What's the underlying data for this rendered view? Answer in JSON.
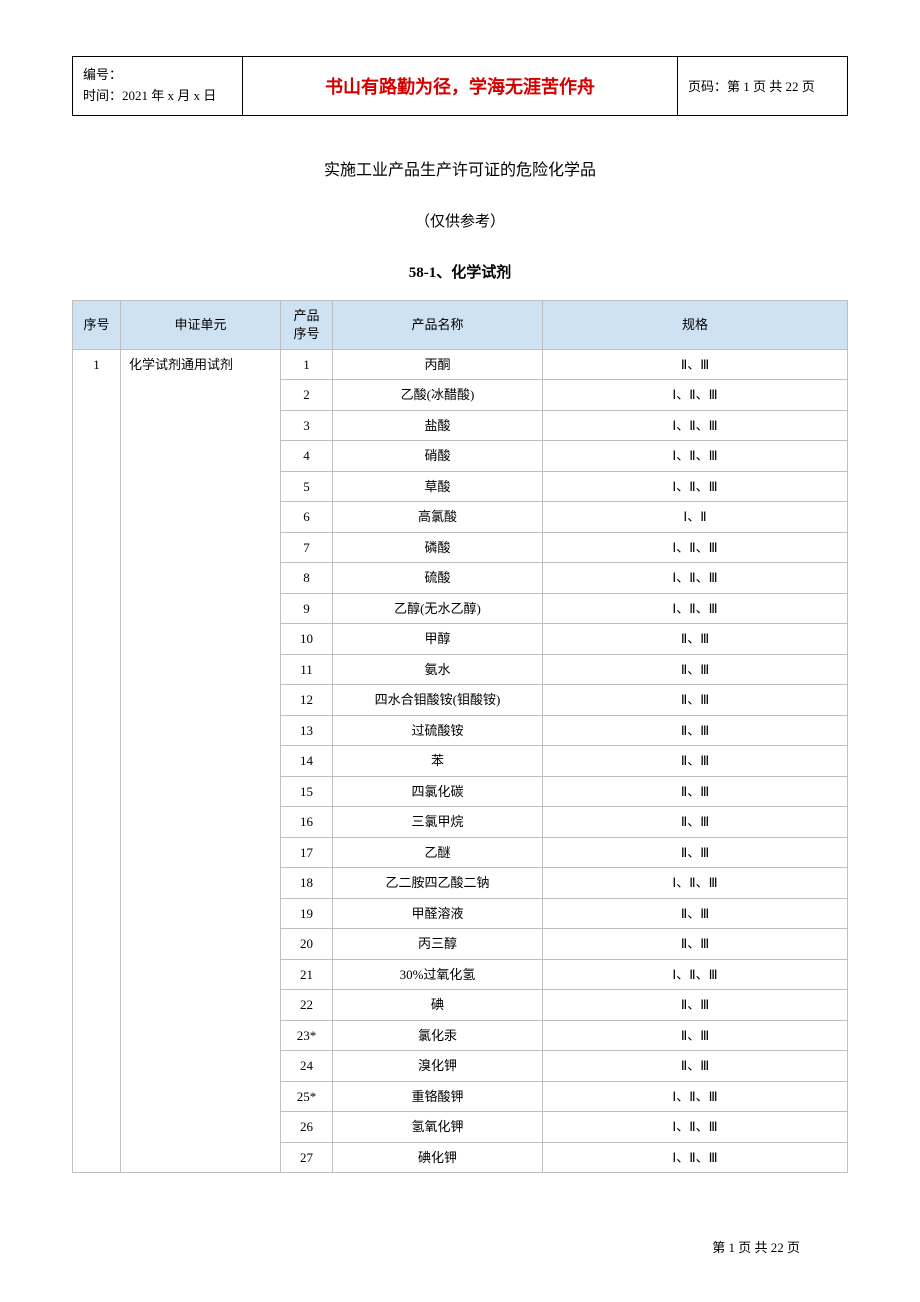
{
  "header": {
    "left_line1": "编号：",
    "left_line2": "时间：2021 年 x 月 x 日",
    "mid": "书山有路勤为径，学海无涯苦作舟",
    "right": "页码：第 1 页  共 22 页"
  },
  "doc": {
    "title": "实施工业产品生产许可证的危险化学品",
    "sub": "（仅供参考）",
    "section": "58-1、化学试剂"
  },
  "table": {
    "headers": {
      "seq": "序号",
      "unit": "申证单元",
      "pn_line1": "产品",
      "pn_line2": "序号",
      "name": "产品名称",
      "spec": "规格"
    },
    "seq_value": "1",
    "unit_value": "化学试剂通用试剂",
    "rows": [
      {
        "pn": "1",
        "name": "丙酮",
        "spec": "Ⅱ、Ⅲ"
      },
      {
        "pn": "2",
        "name": "乙酸(冰醋酸)",
        "spec": "Ⅰ、Ⅱ、Ⅲ"
      },
      {
        "pn": "3",
        "name": "盐酸",
        "spec": "Ⅰ、Ⅱ、Ⅲ"
      },
      {
        "pn": "4",
        "name": "硝酸",
        "spec": "Ⅰ、Ⅱ、Ⅲ"
      },
      {
        "pn": "5",
        "name": "草酸",
        "spec": "Ⅰ、Ⅱ、Ⅲ"
      },
      {
        "pn": "6",
        "name": "高氯酸",
        "spec": "Ⅰ、Ⅱ"
      },
      {
        "pn": "7",
        "name": "磷酸",
        "spec": "Ⅰ、Ⅱ、Ⅲ"
      },
      {
        "pn": "8",
        "name": "硫酸",
        "spec": "Ⅰ、Ⅱ、Ⅲ"
      },
      {
        "pn": "9",
        "name": "乙醇(无水乙醇)",
        "spec": "Ⅰ、Ⅱ、Ⅲ"
      },
      {
        "pn": "10",
        "name": "甲醇",
        "spec": "Ⅱ、Ⅲ"
      },
      {
        "pn": "11",
        "name": "氨水",
        "spec": "Ⅱ、Ⅲ"
      },
      {
        "pn": "12",
        "name": "四水合钼酸铵(钼酸铵)",
        "spec": "Ⅱ、Ⅲ"
      },
      {
        "pn": "13",
        "name": "过硫酸铵",
        "spec": "Ⅱ、Ⅲ"
      },
      {
        "pn": "14",
        "name": "苯",
        "spec": "Ⅱ、Ⅲ"
      },
      {
        "pn": "15",
        "name": "四氯化碳",
        "spec": "Ⅱ、Ⅲ"
      },
      {
        "pn": "16",
        "name": "三氯甲烷",
        "spec": "Ⅱ、Ⅲ"
      },
      {
        "pn": "17",
        "name": "乙醚",
        "spec": "Ⅱ、Ⅲ"
      },
      {
        "pn": "18",
        "name": "乙二胺四乙酸二钠",
        "spec": "Ⅰ、Ⅱ、Ⅲ"
      },
      {
        "pn": "19",
        "name": "甲醛溶液",
        "spec": "Ⅱ、Ⅲ"
      },
      {
        "pn": "20",
        "name": "丙三醇",
        "spec": "Ⅱ、Ⅲ"
      },
      {
        "pn": "21",
        "name": "30%过氧化氢",
        "spec": "Ⅰ、Ⅱ、Ⅲ"
      },
      {
        "pn": "22",
        "name": "碘",
        "spec": "Ⅱ、Ⅲ"
      },
      {
        "pn": "23*",
        "name": "氯化汞",
        "spec": "Ⅱ、Ⅲ"
      },
      {
        "pn": "24",
        "name": "溴化钾",
        "spec": "Ⅱ、Ⅲ"
      },
      {
        "pn": "25*",
        "name": "重铬酸钾",
        "spec": "Ⅰ、Ⅱ、Ⅲ"
      },
      {
        "pn": "26",
        "name": "氢氧化钾",
        "spec": "Ⅰ、Ⅱ、Ⅲ"
      },
      {
        "pn": "27",
        "name": "碘化钾",
        "spec": "Ⅰ、Ⅱ、Ⅲ"
      }
    ]
  },
  "footer": "第 1 页 共 22 页"
}
